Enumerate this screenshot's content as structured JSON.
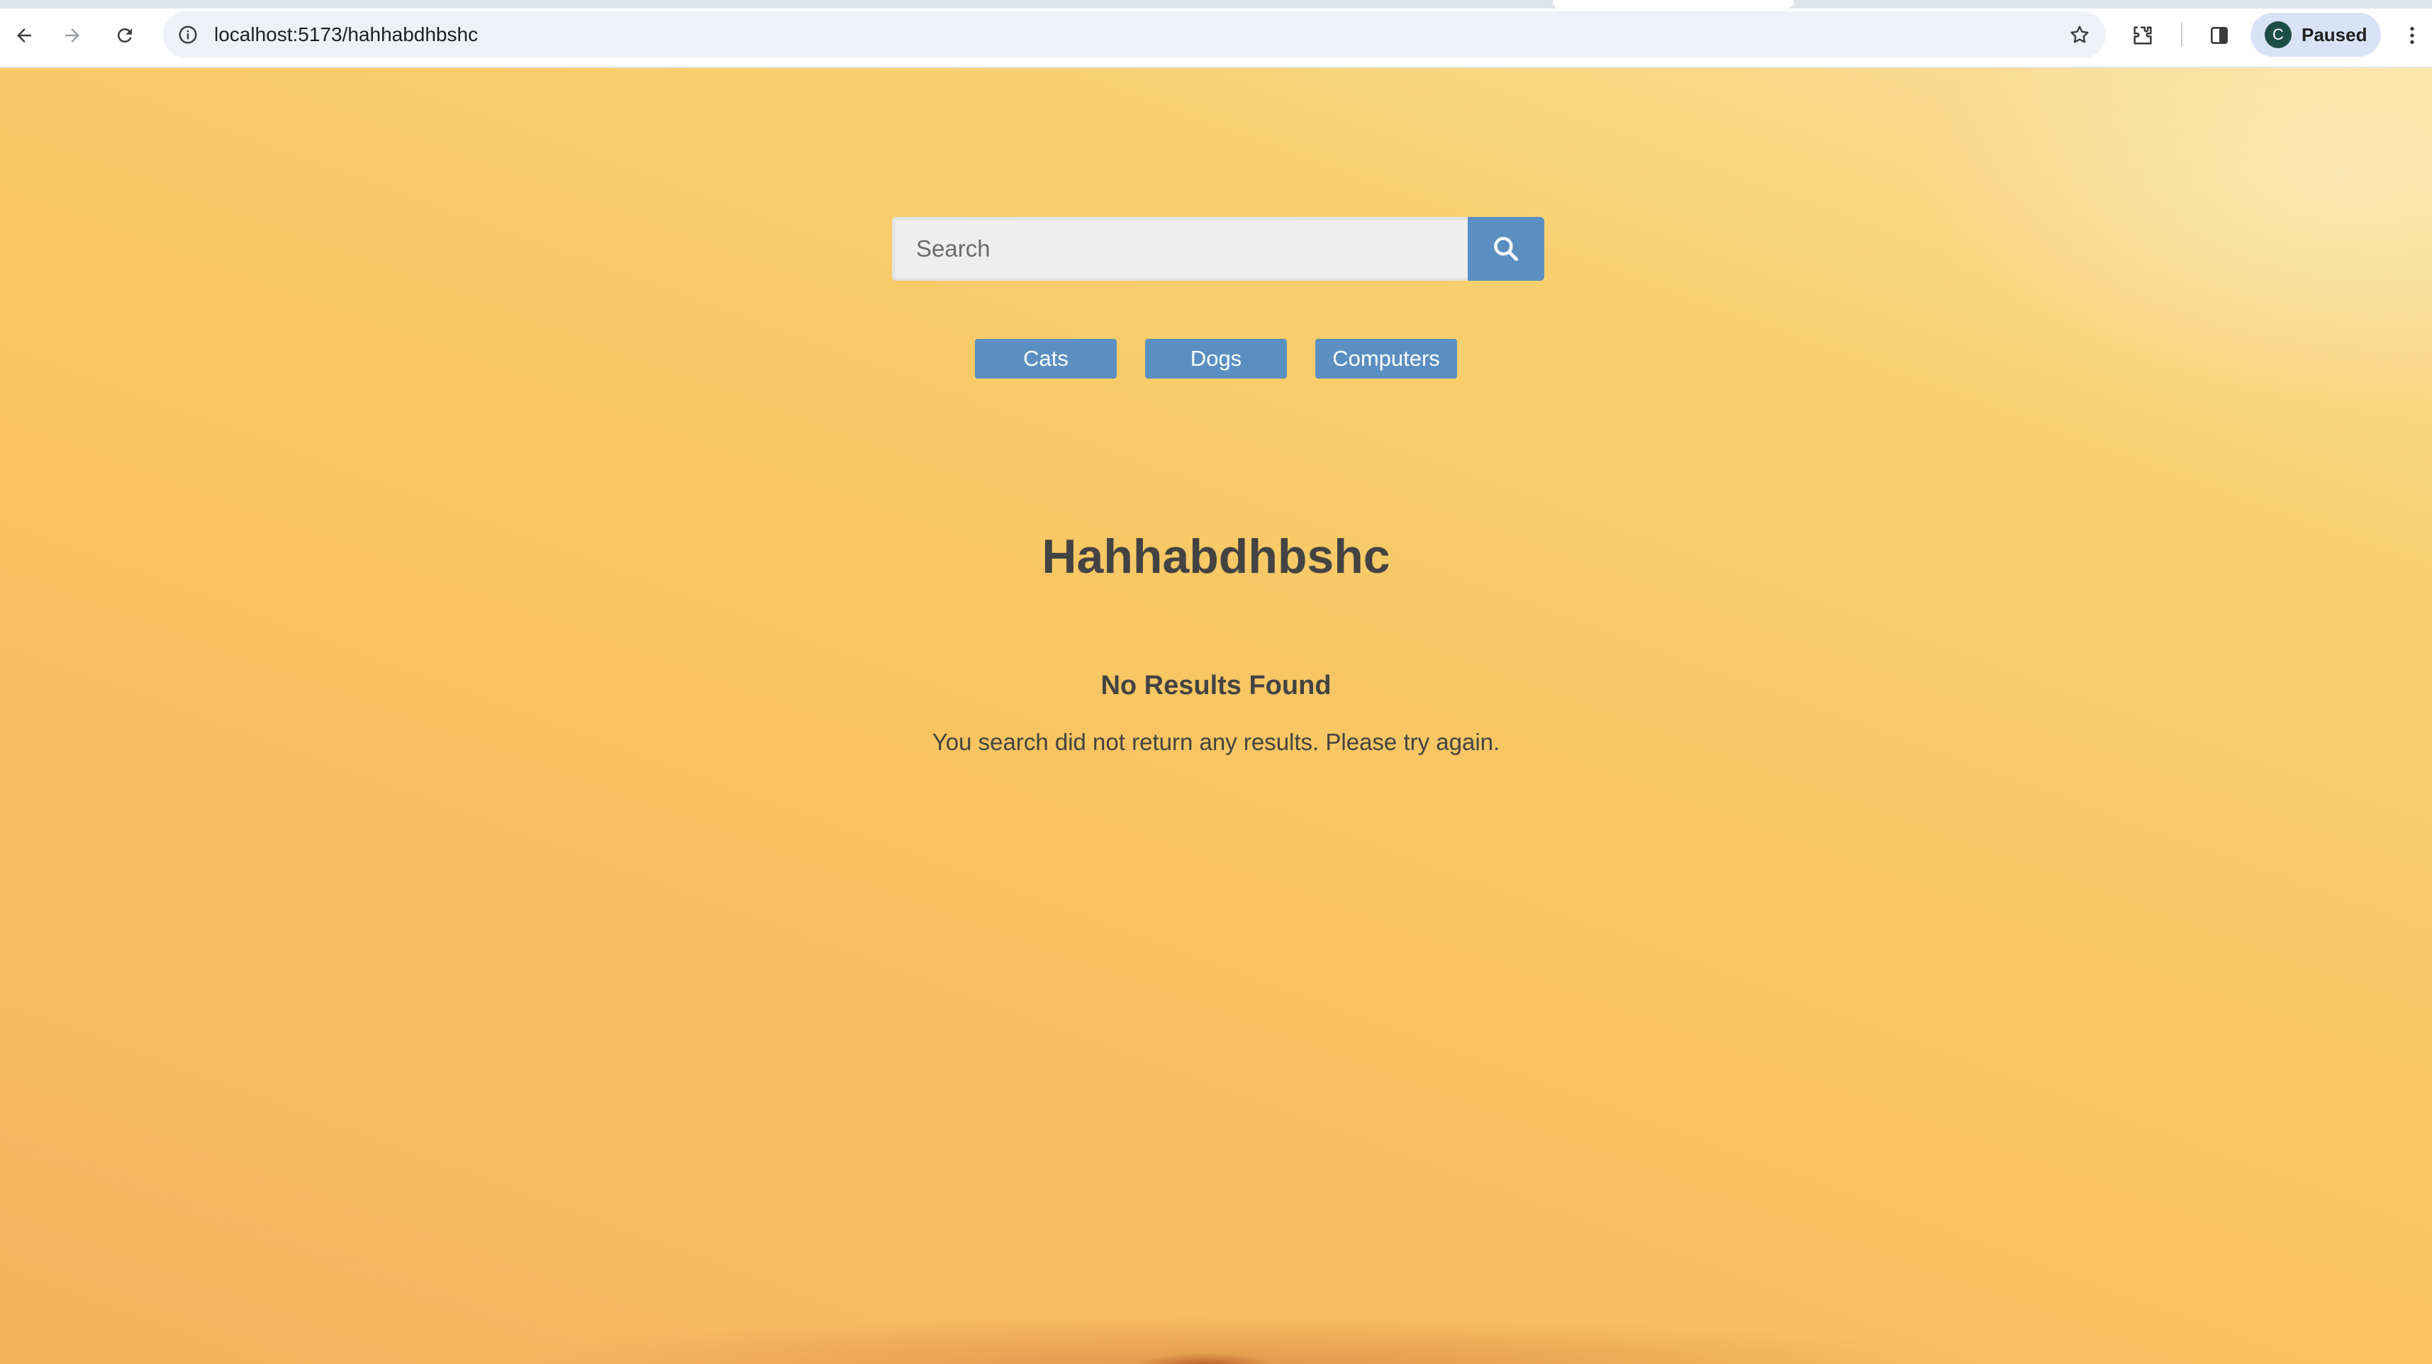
{
  "browser": {
    "url": "localhost:5173/hahhabdhbshc",
    "profile_initial": "C",
    "profile_status": "Paused"
  },
  "page": {
    "search": {
      "placeholder": "Search",
      "value": ""
    },
    "categories": [
      "Cats",
      "Dogs",
      "Computers"
    ],
    "title": "Hahhabdhbshc",
    "no_results": {
      "heading": "No Results Found",
      "message": "You search did not return any results. Please try again."
    }
  },
  "colors": {
    "button_blue": "#5b8fc1",
    "text_dark": "#434343",
    "background_top": "#fae2a0",
    "background_bottom": "#f6b35e"
  },
  "icons": [
    "back-arrow-icon",
    "forward-arrow-icon",
    "reload-icon",
    "info-icon",
    "star-icon",
    "extensions-icon",
    "side-panel-icon",
    "kebab-menu-icon",
    "search-icon"
  ]
}
